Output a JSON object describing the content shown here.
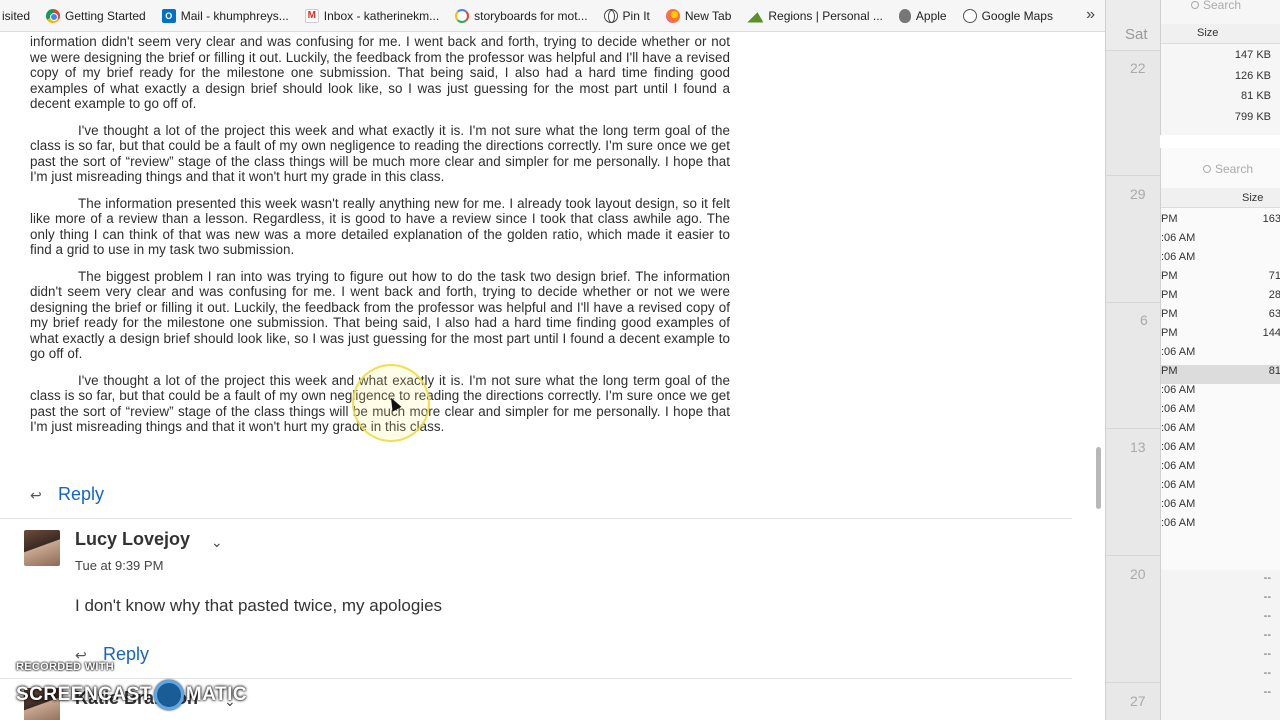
{
  "bookmarks": [
    {
      "label": "isited",
      "icon": "none"
    },
    {
      "label": "Getting Started",
      "icon": "chrome-icon"
    },
    {
      "label": "Mail - khumphreys...",
      "icon": "outlook-icon"
    },
    {
      "label": "Inbox - katherinekm...",
      "icon": "gmail-icon"
    },
    {
      "label": "storyboards for mot...",
      "icon": "google-icon"
    },
    {
      "label": "Pin It",
      "icon": "globe-icon"
    },
    {
      "label": "New Tab",
      "icon": "firefox-icon"
    },
    {
      "label": "Regions | Personal ...",
      "icon": "regions-icon"
    },
    {
      "label": "Apple",
      "icon": "apple-icon"
    },
    {
      "label": "Google Maps",
      "icon": "globe-icon"
    }
  ],
  "bookmarks_more": "»",
  "post": {
    "para_top_1": "information didn't seem very clear and was confusing for me. I went back and forth, trying to decide whether or not we were designing the brief or filling it out. Luckily, the feedback from the professor was helpful and I'll have a revised copy of my brief ready for the milestone one submission. That being said, I also had a hard time finding good examples of what exactly a design brief should look like, so I was just guessing for the most part until I found a decent example to go off of.",
    "para_2": "I've thought a lot of the project this week and what exactly it is. I'm not sure what the long term goal of the class is so far, but that could be a fault of my own negligence to reading the directions correctly. I'm sure once we get past the sort of “review” stage of the class things will be much more clear and simpler for me personally. I hope that I'm just misreading things and that it won't hurt my grade in this class.",
    "para_3": "The information presented this week wasn't really anything new for me. I already took layout design, so it felt like more of a review than a lesson. Regardless, it is good to have a review since I took that class awhile ago. The only thing I can think of that was new was a more detailed explanation of the golden ratio, which made it easier to find a grid to use in my task two submission.",
    "para_4": "The biggest problem I ran into was trying to figure out how to do the task two design brief. The information didn't seem very clear and was confusing for me. I went back and forth, trying to decide whether or not we were designing the brief or filling it out. Luckily, the feedback from the professor was helpful and I'll have a revised copy of my brief ready for the milestone one submission. That being said, I also had a hard time finding good examples of what exactly a design brief should look like, so I was just guessing for the most part until I found a decent example to go off of.",
    "para_5": "I've thought a lot of the project this week and what exactly it is. I'm not sure what the long term goal of the class is so far, but that could be a fault of my own negligence to reading the directions correctly. I'm sure once we get past the sort of “review” stage of the class things will be much more clear and simpler for me personally. I hope that I'm just misreading things and that it won't hurt my grade in this class.",
    "reply_label": "Reply"
  },
  "comment": {
    "author": "Lucy Lovejoy",
    "timestamp": "Tue at 9:39 PM",
    "text": "I don't know why that pasted twice, my apologies",
    "reply_label": "Reply"
  },
  "next_author": "Katie Brandon",
  "watermark": {
    "small": "RECORDED WITH",
    "big_left": "SCREENCAST",
    "big_right": "MATIC"
  },
  "calendar": {
    "day_header": "Sat",
    "dates": [
      "22",
      "29",
      "6",
      "13",
      "20",
      "27"
    ]
  },
  "finder_top": {
    "search_placeholder": "Search",
    "column": "Size",
    "rows": [
      "147 KB",
      "126 KB",
      "81 KB",
      "799 KB"
    ]
  },
  "finder_mid": {
    "search_placeholder": "Search",
    "column": "Size",
    "rows": [
      {
        "time": "PM",
        "size": "163"
      },
      {
        "time": ":06 AM",
        "size": ""
      },
      {
        "time": ":06 AM",
        "size": ""
      },
      {
        "time": "PM",
        "size": "71"
      },
      {
        "time": "PM",
        "size": "28"
      },
      {
        "time": "PM",
        "size": "63"
      },
      {
        "time": "PM",
        "size": "144"
      },
      {
        "time": ":06 AM",
        "size": ""
      },
      {
        "time": "PM",
        "size": "81"
      },
      {
        "time": ":06 AM",
        "size": ""
      },
      {
        "time": ":06 AM",
        "size": ""
      },
      {
        "time": ":06 AM",
        "size": ""
      },
      {
        "time": ":06 AM",
        "size": ""
      },
      {
        "time": ":06 AM",
        "size": ""
      },
      {
        "time": ":06 AM",
        "size": ""
      },
      {
        "time": ":06 AM",
        "size": ""
      },
      {
        "time": ":06 AM",
        "size": ""
      }
    ]
  },
  "finder_bottom": {
    "rows": [
      "--",
      "--",
      "--",
      "--",
      "--",
      "--",
      "--"
    ]
  }
}
